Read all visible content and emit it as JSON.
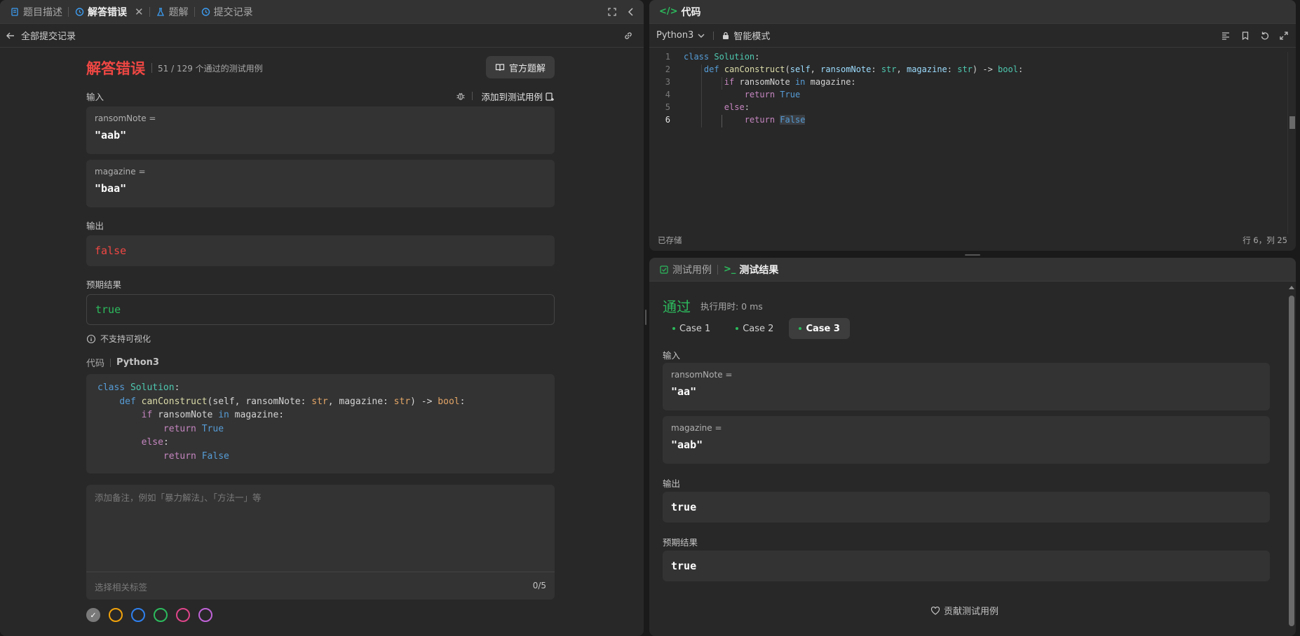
{
  "left_tabs": [
    {
      "label": "题目描述",
      "icon": "document-icon",
      "active": false
    },
    {
      "label": "解答错误",
      "icon": "history-icon",
      "active": true
    },
    {
      "label": "题解",
      "icon": "flask-icon",
      "active": false
    },
    {
      "label": "提交记录",
      "icon": "history-icon",
      "active": false
    }
  ],
  "back_link": "全部提交记录",
  "submission": {
    "status": "解答错误",
    "summary": "51 / 129 个通过的测试用例",
    "official_solution_button": "官方题解",
    "input_label": "输入",
    "add_testcase_label": "添加到测试用例",
    "inputs": [
      {
        "name": "ransomNote =",
        "value": "\"aab\""
      },
      {
        "name": "magazine =",
        "value": "\"baa\""
      }
    ],
    "output_label": "输出",
    "output_value": "false",
    "expected_label": "预期结果",
    "expected_value": "true",
    "visualize_note": "不支持可视化",
    "code_label": "代码",
    "code_language": "Python3",
    "note_placeholder": "添加备注，例如「暴力解法」、「方法一」等",
    "tag_placeholder": "选择相关标签",
    "tag_count": "0/5",
    "color_tags": [
      "#7a7a7a",
      "#f0a20b",
      "#2f80ed",
      "#2cbb5d",
      "#e0458a",
      "#c063d8"
    ]
  },
  "editor": {
    "tab_label": "代码",
    "language": "Python3",
    "mode": "智能模式",
    "line_numbers": [
      "1",
      "2",
      "3",
      "4",
      "5",
      "6"
    ],
    "status_saved": "已存储",
    "cursor_position": "行 6，列 25"
  },
  "results": {
    "tabs": [
      {
        "label": "测试用例",
        "icon": "checkbox-icon",
        "active": false
      },
      {
        "label": "测试结果",
        "icon": "terminal-icon",
        "active": true
      }
    ],
    "status": "通过",
    "runtime": "执行用时: 0 ms",
    "cases": [
      "Case 1",
      "Case 2",
      "Case 3"
    ],
    "active_case": "Case 3",
    "input_label": "输入",
    "inputs": [
      {
        "name": "ransomNote =",
        "value": "\"aa\""
      },
      {
        "name": "magazine =",
        "value": "\"aab\""
      }
    ],
    "output_label": "输出",
    "output_value": "true",
    "expected_label": "预期结果",
    "expected_value": "true",
    "contribute_label": "贡献测试用例"
  },
  "colors": {
    "error_red": "#ef4743",
    "accept_green": "#2cbb5d",
    "link_blue": "#3c9cf1"
  }
}
